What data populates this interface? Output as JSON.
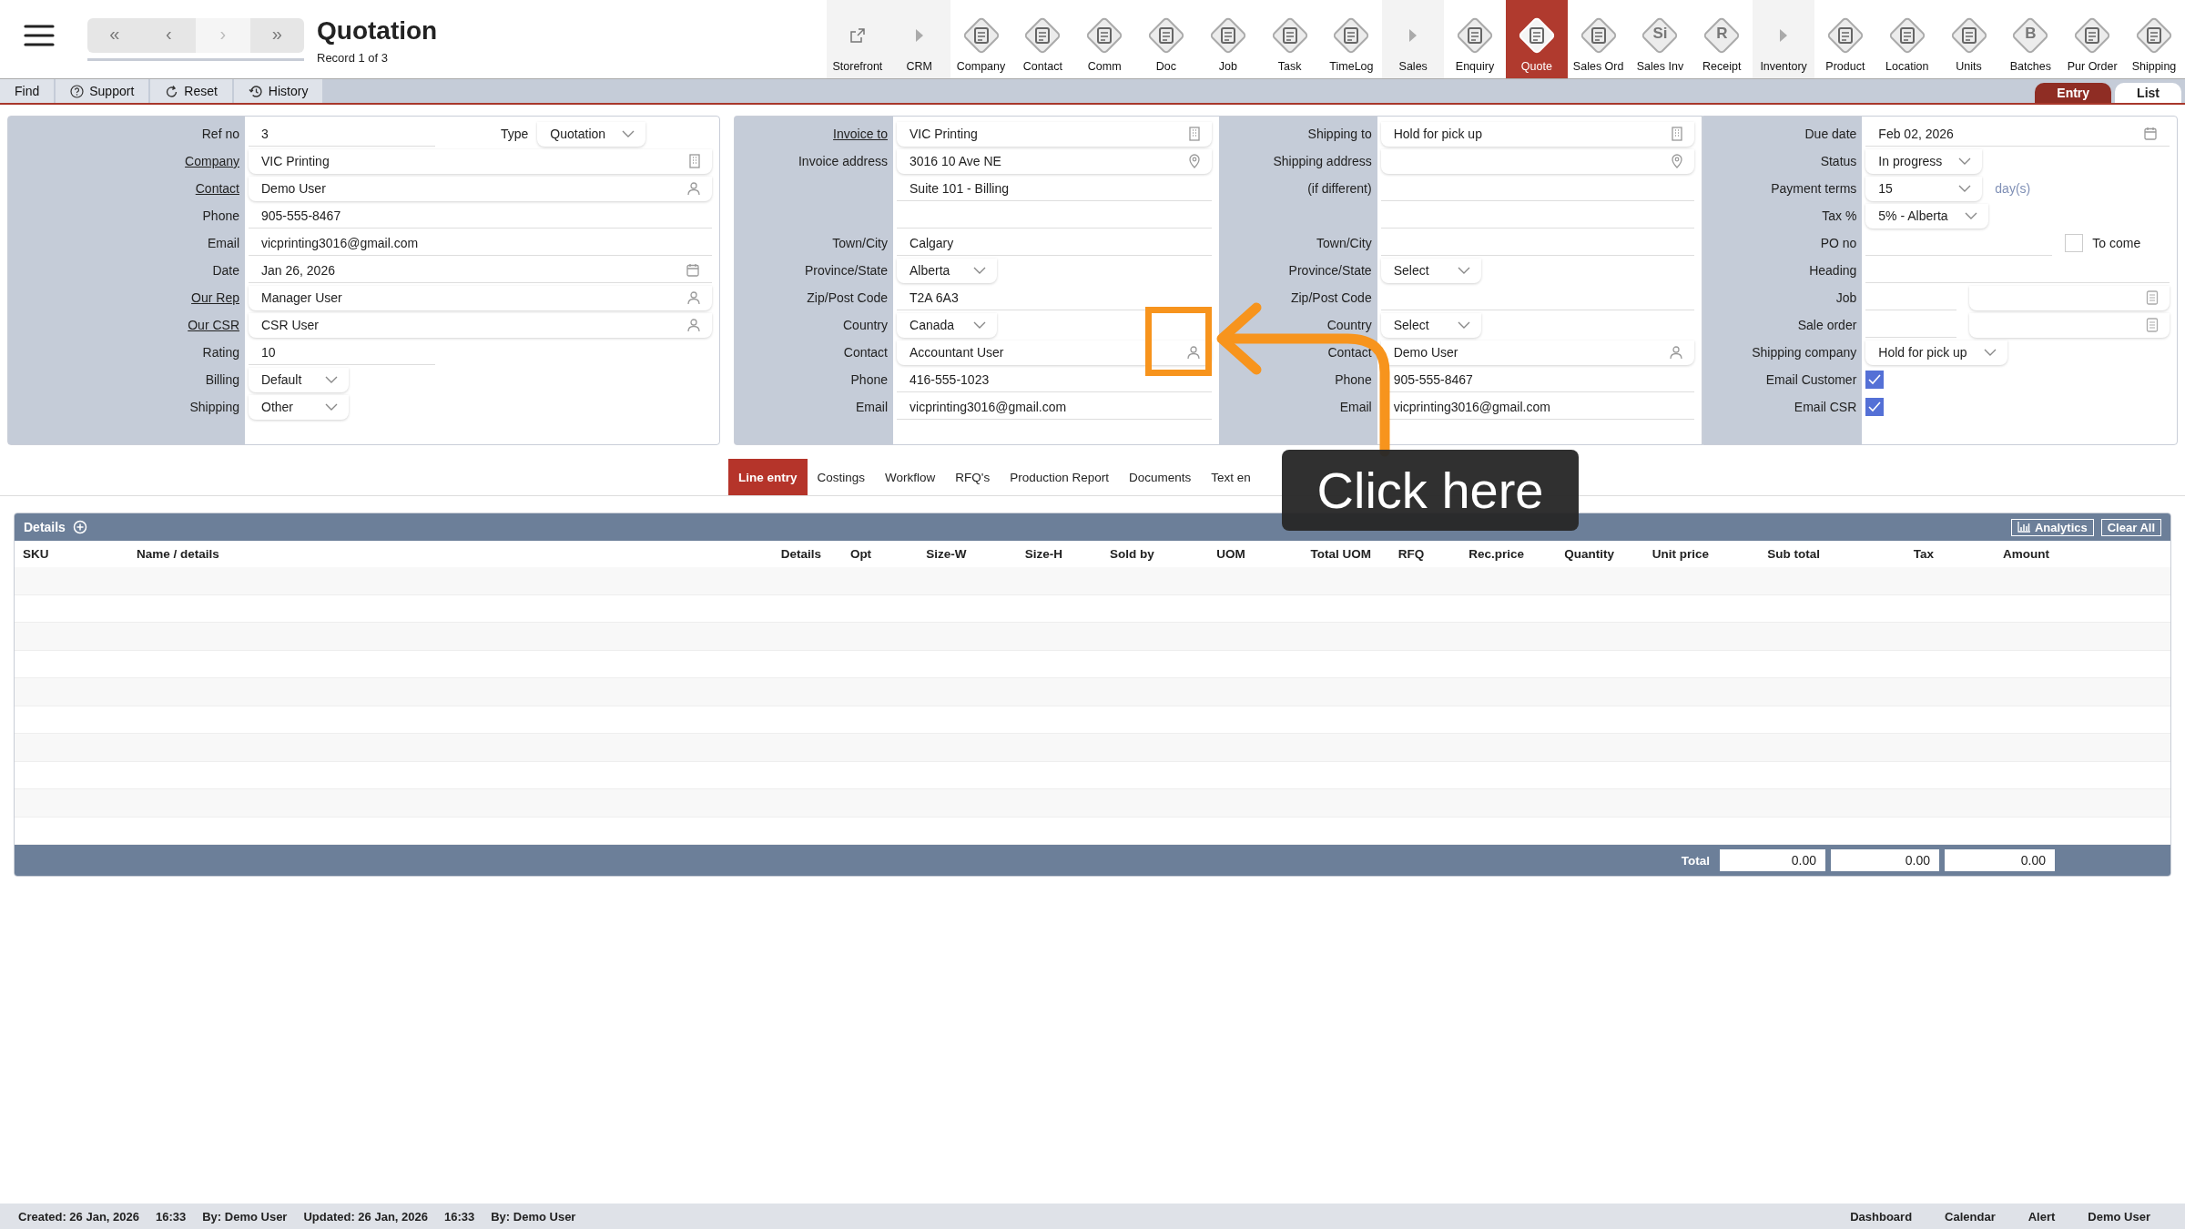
{
  "header": {
    "title": "Quotation",
    "subtitle": "Record 1 of 3",
    "nav": [
      {
        "label": "«",
        "disabled": false
      },
      {
        "label": "‹",
        "disabled": false
      },
      {
        "label": "›",
        "disabled": true
      },
      {
        "label": "»",
        "disabled": false
      }
    ]
  },
  "toolbar": [
    {
      "label": "Storefront",
      "kind": "link",
      "selected": false
    },
    {
      "label": "CRM",
      "kind": "section",
      "selected": false
    },
    {
      "label": "Company",
      "kind": "module",
      "selected": false
    },
    {
      "label": "Contact",
      "kind": "module",
      "selected": false
    },
    {
      "label": "Comm",
      "kind": "module",
      "selected": false
    },
    {
      "label": "Doc",
      "kind": "module",
      "selected": false
    },
    {
      "label": "Job",
      "kind": "module",
      "selected": false
    },
    {
      "label": "Task",
      "kind": "module",
      "selected": false
    },
    {
      "label": "TimeLog",
      "kind": "module",
      "selected": false
    },
    {
      "label": "Sales",
      "kind": "section",
      "selected": false
    },
    {
      "label": "Enquiry",
      "kind": "module",
      "selected": false
    },
    {
      "label": "Quote",
      "kind": "module",
      "selected": true
    },
    {
      "label": "Sales Ord",
      "kind": "module",
      "selected": false
    },
    {
      "label": "Sales Inv",
      "kind": "module",
      "selected": false,
      "glyph": "Si"
    },
    {
      "label": "Receipt",
      "kind": "module",
      "selected": false,
      "glyph": "R"
    },
    {
      "label": "Inventory",
      "kind": "section",
      "selected": false
    },
    {
      "label": "Product",
      "kind": "module",
      "selected": false
    },
    {
      "label": "Location",
      "kind": "module",
      "selected": false
    },
    {
      "label": "Units",
      "kind": "module",
      "selected": false
    },
    {
      "label": "Batches",
      "kind": "module",
      "selected": false,
      "glyph": "B"
    },
    {
      "label": "Pur Order",
      "kind": "module",
      "selected": false
    },
    {
      "label": "Shipping",
      "kind": "module",
      "selected": false
    }
  ],
  "actions": [
    {
      "label": "Find",
      "kind": "plain"
    },
    {
      "label": "Support",
      "kind": "help"
    },
    {
      "label": "Reset",
      "kind": "reset"
    },
    {
      "label": "History",
      "kind": "history"
    }
  ],
  "view_tabs": [
    {
      "label": "Entry",
      "selected": true
    },
    {
      "label": "List",
      "selected": false
    }
  ],
  "form": {
    "panels": [
      {
        "rows": [
          {
            "label": "Ref no",
            "link": false,
            "kind": "short",
            "value": "3",
            "type": {
              "label": "Type",
              "value": "Quotation"
            }
          },
          {
            "label": "Company",
            "link": true,
            "kind": "company-lookup",
            "value": "VIC Printing"
          },
          {
            "label": "Contact",
            "link": true,
            "kind": "person-lookup",
            "value": "Demo User"
          },
          {
            "label": "Phone",
            "link": false,
            "kind": "text",
            "value": "905-555-8467"
          },
          {
            "label": "Email",
            "link": false,
            "kind": "text",
            "value": "vicprinting3016@gmail.com"
          },
          {
            "label": "Date",
            "link": false,
            "kind": "date",
            "value": "Jan 26, 2026"
          },
          {
            "label": "Our Rep",
            "link": true,
            "kind": "person-lookup",
            "value": "Manager User"
          },
          {
            "label": "Our CSR",
            "link": true,
            "kind": "person-lookup",
            "value": "CSR User"
          },
          {
            "label": "Rating",
            "link": false,
            "kind": "short",
            "value": "10"
          },
          {
            "label": "Billing",
            "link": false,
            "kind": "select",
            "value": "Default"
          },
          {
            "label": "Shipping",
            "link": false,
            "kind": "select",
            "value": "Other"
          }
        ]
      },
      {
        "rows": [
          {
            "label": "Invoice to",
            "link": true,
            "kind": "company-lookup",
            "value": "VIC Printing"
          },
          {
            "label": "Invoice address",
            "link": false,
            "kind": "address-lookup",
            "value": "3016 10 Ave NE"
          },
          {
            "kind": "text",
            "value": "Suite 101 - Billing"
          },
          {
            "kind": "text"
          },
          {
            "label": "Town/City",
            "link": false,
            "kind": "text",
            "value": "Calgary"
          },
          {
            "label": "Province/State",
            "link": false,
            "kind": "select",
            "value": "Alberta"
          },
          {
            "label": "Zip/Post Code",
            "link": false,
            "kind": "text",
            "value": "T2A 6A3"
          },
          {
            "label": "Country",
            "link": false,
            "kind": "select",
            "value": "Canada"
          },
          {
            "label": "Contact",
            "link": false,
            "kind": "person-lookup",
            "value": "Accountant User"
          },
          {
            "label": "Phone",
            "link": false,
            "kind": "text",
            "value": "416-555-1023"
          },
          {
            "label": "Email",
            "link": false,
            "kind": "text",
            "value": "vicprinting3016@gmail.com"
          }
        ]
      },
      {
        "rows": [
          {
            "label": "Shipping to",
            "link": false,
            "kind": "company-lookup",
            "value": "Hold for pick up"
          },
          {
            "label": "Shipping address",
            "link": false,
            "kind": "address-lookup"
          },
          {
            "label": "(if different)",
            "link": false,
            "kind": "text"
          },
          {
            "kind": "text"
          },
          {
            "label": "Town/City",
            "link": false,
            "kind": "text"
          },
          {
            "label": "Province/State",
            "link": false,
            "kind": "select",
            "value": "Select"
          },
          {
            "label": "Zip/Post Code",
            "link": false,
            "kind": "text"
          },
          {
            "label": "Country",
            "link": false,
            "kind": "select",
            "value": "Select"
          },
          {
            "label": "Contact",
            "link": false,
            "kind": "person-lookup",
            "value": "Demo User"
          },
          {
            "label": "Phone",
            "link": false,
            "kind": "text",
            "value": "905-555-8467"
          },
          {
            "label": "Email",
            "link": false,
            "kind": "text",
            "value": "vicprinting3016@gmail.com"
          }
        ]
      },
      {
        "rows": [
          {
            "label": "Due date",
            "link": false,
            "kind": "date",
            "value": "Feb 02, 2026"
          },
          {
            "label": "Status",
            "link": false,
            "kind": "select",
            "value": "In progress"
          },
          {
            "label": "Payment terms",
            "link": false,
            "kind": "select",
            "value": "15",
            "suffix": "day(s)"
          },
          {
            "label": "Tax %",
            "link": false,
            "kind": "select",
            "value": "5% - Alberta"
          },
          {
            "label": "PO no",
            "link": false,
            "kind": "short",
            "check": {
              "label": "To come",
              "checked": false
            }
          },
          {
            "label": "Heading",
            "link": false,
            "kind": "text"
          },
          {
            "label": "Job",
            "link": false,
            "kind": "pair"
          },
          {
            "label": "Sale order",
            "link": false,
            "kind": "pair"
          },
          {
            "label": "Shipping company",
            "link": false,
            "kind": "select",
            "value": "Hold for pick up"
          },
          {
            "label": "Email Customer",
            "link": false,
            "kind": "checkbox",
            "checked": true
          },
          {
            "label": "Email CSR",
            "link": false,
            "kind": "checkbox",
            "checked": true
          }
        ]
      }
    ]
  },
  "tabs": [
    {
      "label": "Line entry",
      "selected": true
    },
    {
      "label": "Costings",
      "selected": false
    },
    {
      "label": "Workflow",
      "selected": false
    },
    {
      "label": "RFQ's",
      "selected": false
    },
    {
      "label": "Production Report",
      "selected": false
    },
    {
      "label": "Documents",
      "selected": false
    },
    {
      "label": "Text en",
      "selected": false
    }
  ],
  "details": {
    "title": "Details",
    "buttons": [
      {
        "label": "Analytics",
        "kind": "analytics"
      },
      {
        "label": "Clear All",
        "kind": "plain"
      }
    ],
    "columns": [
      "SKU",
      "Name / details",
      "Details",
      "Opt",
      "Size-W",
      "Size-H",
      "Sold by",
      "UOM",
      "Total UOM",
      "RFQ",
      "Rec.price",
      "Quantity",
      "Unit price",
      "Sub total",
      "Tax",
      "Amount"
    ],
    "total_label": "Total",
    "totals": [
      "0.00",
      "0.00",
      "0.00"
    ]
  },
  "status_bar": {
    "left": [
      "Created: 26 Jan, 2026",
      "16:33",
      "By: Demo User",
      "Updated: 26 Jan, 2026",
      "16:33",
      "By: Demo User"
    ],
    "right": [
      "Dashboard",
      "Calendar",
      "Alert",
      "Demo User"
    ]
  },
  "callout": {
    "text": "Click here"
  }
}
